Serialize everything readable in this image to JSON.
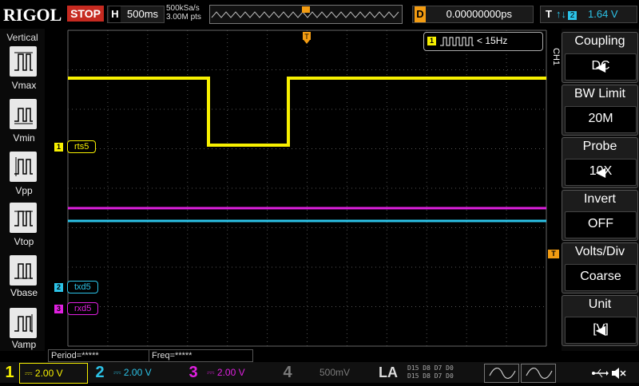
{
  "top": {
    "logo": "RIGOL",
    "run_state": "STOP",
    "h_label": "H",
    "timebase": "500ms",
    "sample_rate": "500kSa/s",
    "mem_depth": "3.00M pts",
    "d_label": "D",
    "delay": "0.00000000ps",
    "t_label": "T",
    "trigger_source": "2",
    "trigger_level": "1.64 V"
  },
  "left_panel": {
    "title": "Vertical",
    "items": [
      "Vmax",
      "Vmin",
      "Vpp",
      "Vtop",
      "Vbase",
      "Vamp"
    ]
  },
  "screen": {
    "freq_badge_ch": "1",
    "freq_badge_text": "< 15Hz",
    "labels": [
      {
        "ch": "1",
        "text": "rts5",
        "color": "#f7f000"
      },
      {
        "ch": "2",
        "text": "txd5",
        "color": "#2cc3e8"
      },
      {
        "ch": "3",
        "text": "rxd5",
        "color": "#e020e0"
      }
    ]
  },
  "right_panel": {
    "tab": "CH1",
    "menus": [
      {
        "title": "Coupling",
        "value": "DC",
        "arrow": true
      },
      {
        "title": "BW Limit",
        "value": "20M",
        "arrow": false
      },
      {
        "title": "Probe",
        "value": "10X",
        "arrow": true
      },
      {
        "title": "Invert",
        "value": "OFF",
        "arrow": false
      },
      {
        "title": "Volts/Div",
        "value": "Coarse",
        "arrow": false
      },
      {
        "title": "Unit",
        "value": "[V]",
        "arrow": true
      }
    ]
  },
  "measurements": {
    "period": "Period=*****",
    "freq": "Freq=*****"
  },
  "bottom": {
    "channels": [
      {
        "num": "1",
        "scale": "2.00 V",
        "color": "#f7f000",
        "active": true
      },
      {
        "num": "2",
        "scale": "2.00 V",
        "color": "#2cc3e8",
        "active": true
      },
      {
        "num": "3",
        "scale": "2.00 V",
        "color": "#e020e0",
        "active": true
      },
      {
        "num": "4",
        "scale": "500mV",
        "color": "#4a90e2",
        "active": false
      }
    ],
    "la_label": "LA",
    "la_digits_top": "D15 D8 D7 D0",
    "la_digits_bottom": "D15 D8 D7 D0"
  },
  "colors": {
    "ch1": "#f7f000",
    "ch2": "#2cc3e8",
    "ch3": "#e020e0",
    "trigger": "#f39c12"
  },
  "icons": [
    "usb-icon",
    "speaker-mute-icon"
  ]
}
